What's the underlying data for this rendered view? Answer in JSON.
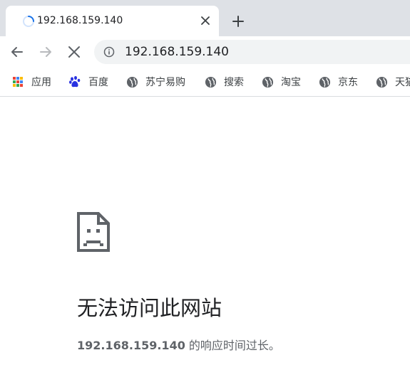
{
  "tab": {
    "title": "192.168.159.140",
    "loading_icon": "spinner-icon",
    "close_icon": "close-icon"
  },
  "new_tab_icon": "plus-icon",
  "toolbar": {
    "back_icon": "arrow-left-icon",
    "forward_icon": "arrow-right-icon",
    "stop_icon": "close-icon",
    "info_icon": "info-icon",
    "url": "192.168.159.140"
  },
  "bookmarks": [
    {
      "label": "应用",
      "icon": "apps-grid-icon"
    },
    {
      "label": "百度",
      "icon": "baidu-paw-icon"
    },
    {
      "label": "苏宁易购",
      "icon": "globe-icon"
    },
    {
      "label": "搜索",
      "icon": "globe-icon"
    },
    {
      "label": "淘宝",
      "icon": "globe-icon"
    },
    {
      "label": "京东",
      "icon": "globe-icon"
    },
    {
      "label": "天猫",
      "icon": "globe-icon"
    }
  ],
  "error": {
    "icon": "sad-document-icon",
    "title": "无法访问此网站",
    "host": "192.168.159.140",
    "message": " 的响应时间过长。"
  },
  "colors": {
    "tabstrip_bg": "#dee1e6",
    "omnibox_bg": "#f1f3f4",
    "spinner_blue": "#1a73e8",
    "baidu_blue": "#2932e1",
    "text_primary": "#202124",
    "text_secondary": "#5f6368"
  }
}
